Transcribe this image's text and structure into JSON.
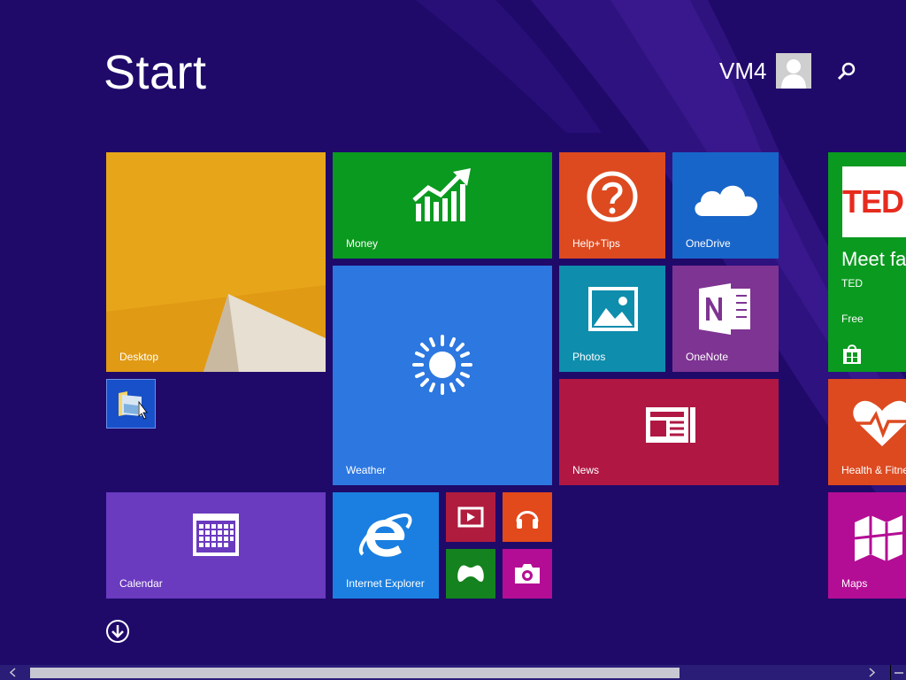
{
  "header": {
    "title": "Start",
    "user_name": "VM4"
  },
  "tiles": {
    "desktop": "Desktop",
    "money": "Money",
    "help_tips": "Help+Tips",
    "onedrive": "OneDrive",
    "weather": "Weather",
    "photos": "Photos",
    "onenote": "OneNote",
    "news": "News",
    "calendar": "Calendar",
    "internet_explorer": "Internet Explorer",
    "ted": {
      "heading": "Meet fas",
      "publisher": "TED",
      "price": "Free",
      "logo_text": "TED"
    },
    "health": "Health & Fitne",
    "maps": "Maps"
  },
  "icons": {
    "search": "search-icon",
    "scroll_down": "arrow-down-icon",
    "user": "user-avatar-icon"
  },
  "colors": {
    "background": "#1f0a6a",
    "desktop_tile": "#e7a619",
    "money_tile": "#0a9a1f",
    "help_tile": "#dd4a20",
    "onedrive_tile": "#1865c9",
    "weather_tile": "#2d77e0",
    "photos_tile": "#0f8dad",
    "onenote_tile": "#7e3492",
    "news_tile": "#b01843",
    "calendar_tile": "#6a3abf",
    "ie_tile": "#1a7fe0",
    "video_tile": "#b01c3e",
    "music_tile": "#e2491b",
    "games_tile": "#14821e",
    "camera_tile": "#b40d95",
    "ted_tile": "#0a9a1f",
    "health_tile": "#dd4a20",
    "maps_tile": "#b40d95"
  }
}
